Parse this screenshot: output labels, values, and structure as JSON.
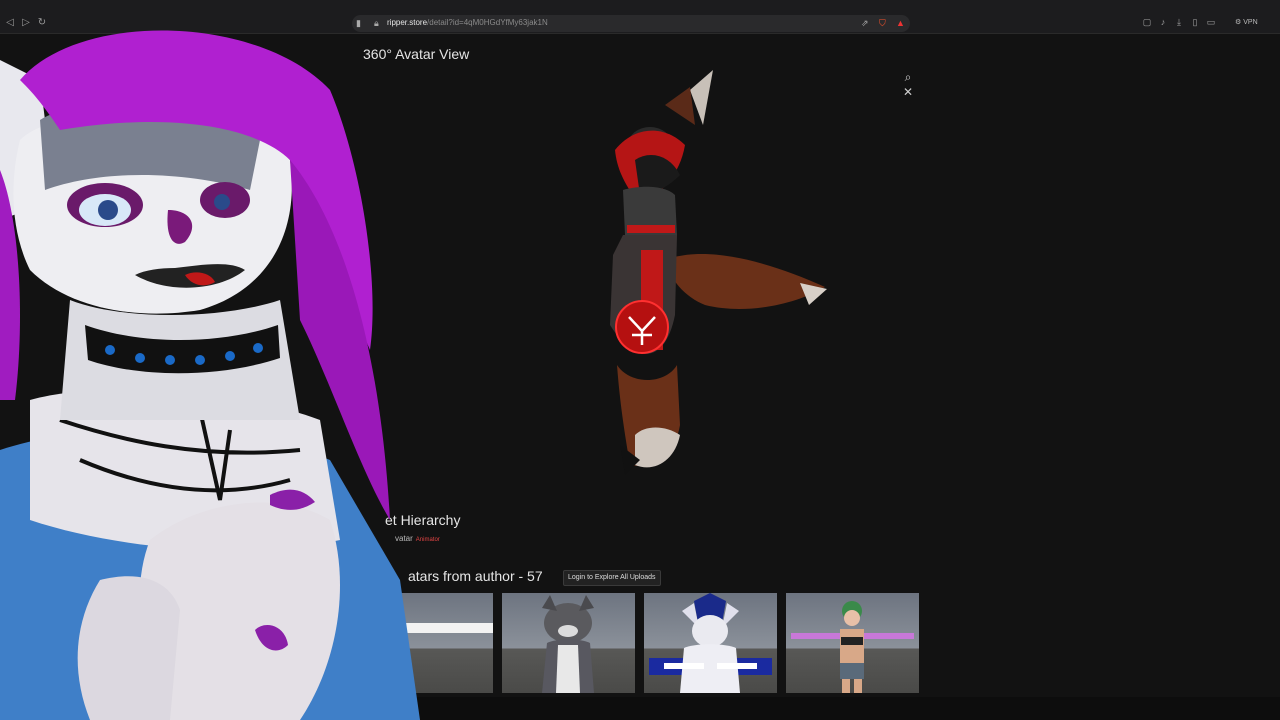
{
  "browser": {
    "url_host": "ripper.store",
    "url_path": "/detail?id=4qM0HGdYfMy63jak1N",
    "vpn_label": "VPN"
  },
  "viewer": {
    "title": "360° Avatar View"
  },
  "hierarchy": {
    "title_visible": "et Hierarchy",
    "item_label": "vatar",
    "item_badge": "Animator"
  },
  "author": {
    "title_visible": "atars from author - 57",
    "login_button": "Login to Explore All Uploads"
  },
  "colors": {
    "background": "#121212",
    "overlay_hair": "#b020d0",
    "avatar_accent": "#d01818"
  },
  "icons": [
    "back-icon",
    "forward-icon",
    "reload-icon",
    "bookmark-icon",
    "lock-icon",
    "share-icon",
    "brave-shield-icon",
    "rewards-icon",
    "search-icon",
    "close-icon"
  ]
}
